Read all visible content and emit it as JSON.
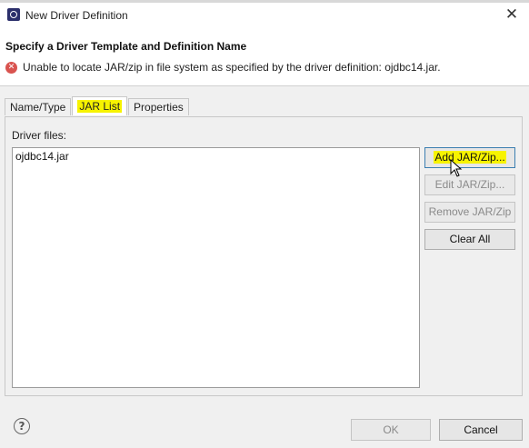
{
  "window": {
    "title": "New Driver Definition",
    "close_glyph": "✕"
  },
  "header": {
    "title": "Specify a Driver Template and Definition Name",
    "error_message": "Unable to locate JAR/zip in file system as specified by the driver definition: ojdbc14.jar."
  },
  "tabs": [
    {
      "label": "Name/Type",
      "active": false
    },
    {
      "label": "JAR List",
      "active": true,
      "highlighted": true
    },
    {
      "label": "Properties",
      "active": false
    }
  ],
  "jar_list": {
    "label": "Driver files:",
    "files": [
      "ojdbc14.jar"
    ],
    "buttons": {
      "add": "Add JAR/Zip...",
      "edit": "Edit JAR/Zip...",
      "remove": "Remove JAR/Zip",
      "clear": "Clear All"
    }
  },
  "footer": {
    "help_glyph": "?",
    "ok": "OK",
    "cancel": "Cancel"
  },
  "colors": {
    "highlight": "#f7f300",
    "error": "#d9534f",
    "dialog_background": "#f0f0f0"
  },
  "icons": [
    "app-icon",
    "close-icon",
    "error-icon",
    "help-icon",
    "mouse-pointer-icon"
  ]
}
